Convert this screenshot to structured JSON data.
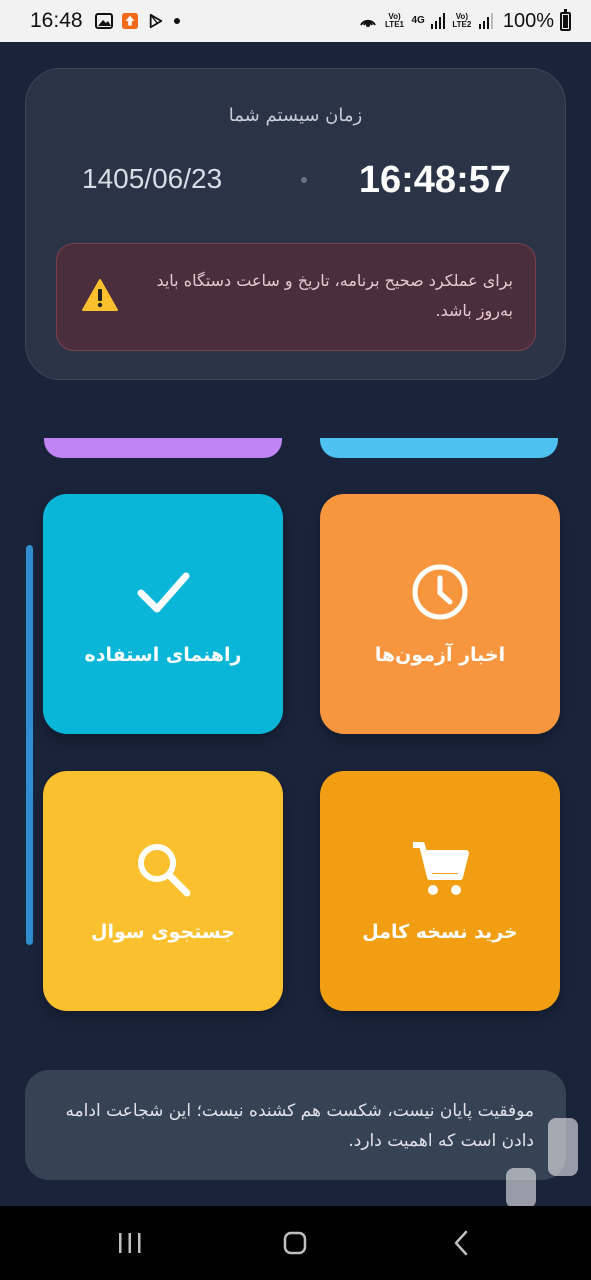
{
  "status_bar": {
    "time": "16:48",
    "sim1": "Vo) LTE1",
    "net1": "4G",
    "sim2": "Vo) LTE2",
    "battery": "100%"
  },
  "system_time": {
    "title": "زمان سیستم شما",
    "date": "1405/06/23",
    "time": "16:48:57",
    "warning": "برای عملکرد صحیح برنامه، تاریخ و ساعت دستگاه باید به‌روز باشد."
  },
  "tiles": [
    {
      "label": "راهنمای استفاده",
      "icon": "checkmark-icon",
      "color": "#0ab6d8"
    },
    {
      "label": "اخبار آزمون‌ها",
      "icon": "clock-icon",
      "color": "#f7963e"
    },
    {
      "label": "جستجوی سوال",
      "icon": "search-icon",
      "color": "#fbc02d"
    },
    {
      "label": "خرید نسخه کامل",
      "icon": "cart-icon",
      "color": "#f29e12"
    }
  ],
  "quote": "موفقیت پایان نیست، شکست هم کشنده نیست؛ این شجاعت ادامه دادن است که اهمیت دارد.",
  "nav": {
    "recents": "recents-icon",
    "home": "home-icon",
    "back": "back-icon"
  }
}
